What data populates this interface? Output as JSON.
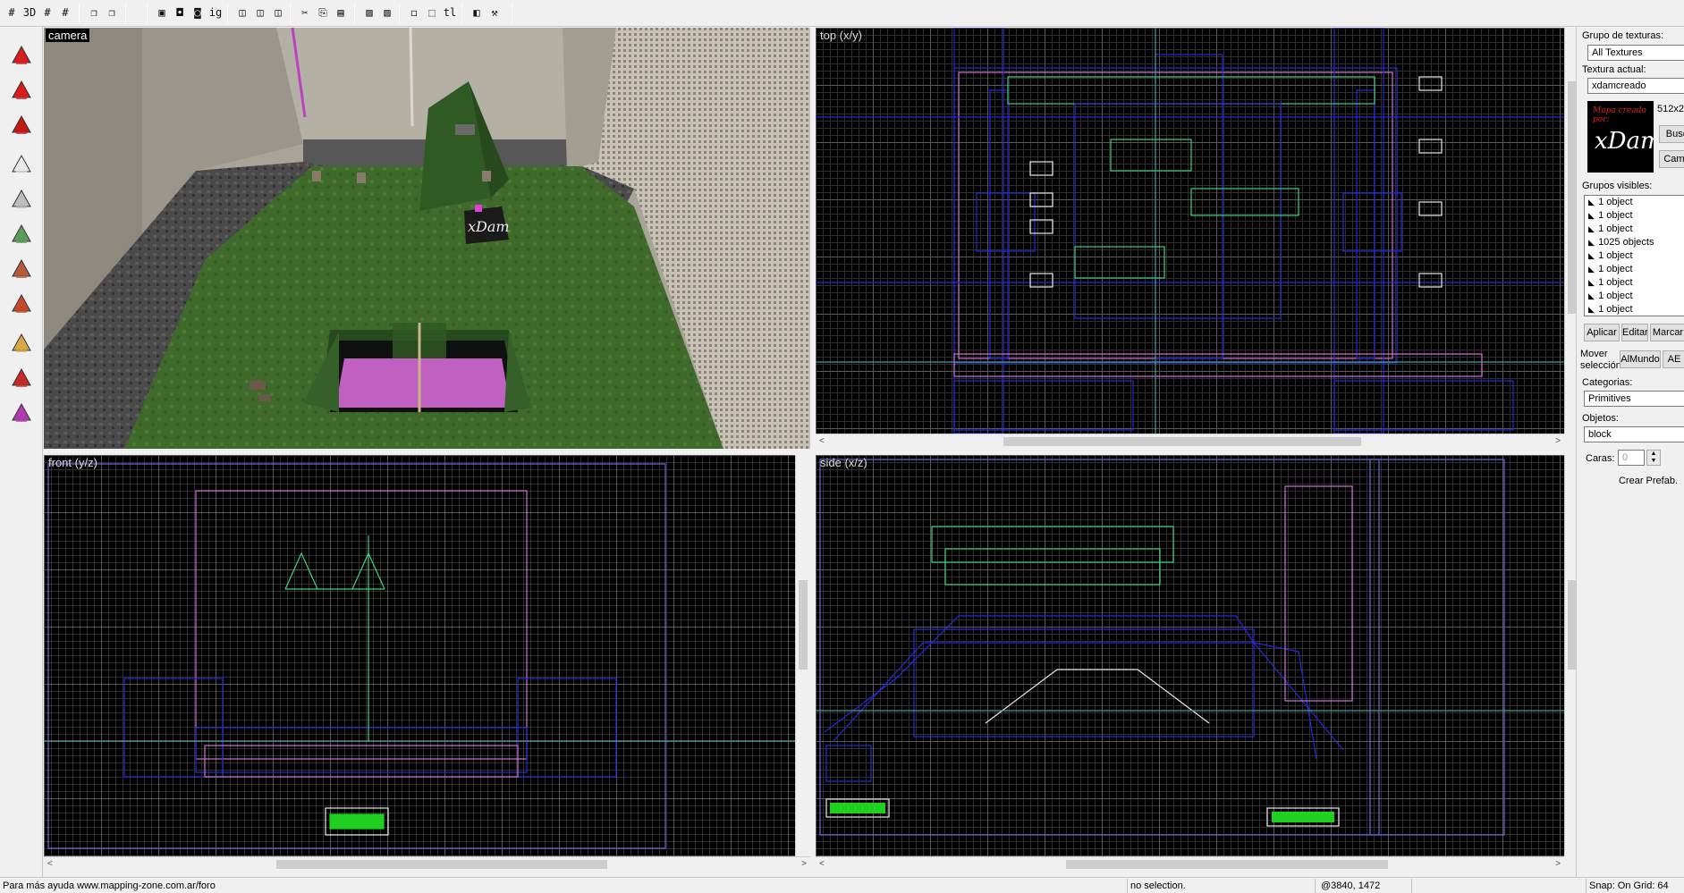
{
  "toolbar": {
    "buttons": [
      {
        "name": "grid-icon",
        "glyph": "#"
      },
      {
        "name": "grid-3d-icon",
        "glyph": "3D"
      },
      {
        "name": "grid-small-icon",
        "glyph": "#"
      },
      {
        "name": "grid-add-icon",
        "glyph": "#"
      },
      {
        "name": "layers-icon",
        "glyph": "❐"
      },
      {
        "name": "layers-alt-icon",
        "glyph": "❐"
      },
      {
        "name": "save-icon",
        "glyph": "▣"
      },
      {
        "name": "camera-icon",
        "glyph": "◘"
      },
      {
        "name": "map-icon",
        "glyph": "◙"
      },
      {
        "name": "ig-icon",
        "glyph": "ig"
      },
      {
        "name": "brush-red-icon",
        "glyph": "◫"
      },
      {
        "name": "brush-outline-icon",
        "glyph": "◫"
      },
      {
        "name": "brush-clone-icon",
        "glyph": "◫"
      },
      {
        "name": "cut-icon",
        "glyph": "✂"
      },
      {
        "name": "copy-icon",
        "glyph": "⎘"
      },
      {
        "name": "paste-icon",
        "glyph": "▤"
      },
      {
        "name": "hazard-icon",
        "glyph": "▨"
      },
      {
        "name": "hazard-x-icon",
        "glyph": "▨"
      },
      {
        "name": "select-box-icon",
        "glyph": "◻"
      },
      {
        "name": "select-cursor-icon",
        "glyph": "⬚"
      },
      {
        "name": "tl-icon",
        "glyph": "tl"
      },
      {
        "name": "flip-icon",
        "glyph": "◧"
      },
      {
        "name": "tools-icon",
        "glyph": "⚒"
      }
    ]
  },
  "palette": {
    "tools": [
      {
        "name": "pointer-tool-icon",
        "color": "#d91c1c"
      },
      {
        "name": "magnify-tool-icon",
        "color": "#d91c1c"
      },
      {
        "name": "cube-red-tool-icon",
        "color": "#c41a1a"
      },
      {
        "name": "light-tool-icon",
        "color": "#e8e8e8"
      },
      {
        "name": "block-tool-icon",
        "color": "#bdbdbd"
      },
      {
        "name": "texture-tool-icon",
        "color": "#5a9c5a"
      },
      {
        "name": "texture-brown-tool-icon",
        "color": "#b45a3c"
      },
      {
        "name": "clip-tool-icon",
        "color": "#c44a2a"
      },
      {
        "name": "decal-tool-icon",
        "color": "#d8a848"
      },
      {
        "name": "vertex-tool-icon",
        "color": "#c42a2a"
      },
      {
        "name": "path-tool-icon",
        "color": "#b03ab0"
      }
    ]
  },
  "viewports": {
    "camera": {
      "label": "camera"
    },
    "top": {
      "label": "top (x/y)"
    },
    "front": {
      "label": "front (y/z)"
    },
    "side": {
      "label": "side (x/z)"
    }
  },
  "camera_scene": {
    "sign_text": "xDam"
  },
  "right_panel": {
    "texture_group_label": "Grupo de texturas:",
    "texture_group_value": "All Textures",
    "current_texture_label": "Textura actual:",
    "current_texture_value": "xdamcreado",
    "texture_size": "512x2",
    "preview_line1": "Mapa creado por:",
    "preview_line2": "xDam'",
    "search_button": "Busc",
    "change_button": "Camb",
    "visible_groups_label": "Grupos visibles:",
    "groups": [
      "1 object",
      "1 object",
      "1 object",
      "1025 objects",
      "1 object",
      "1 object",
      "1 object",
      "1 object",
      "1 object"
    ],
    "apply_button": "Aplicar",
    "edit_button": "Editar",
    "mark_button": "Marcar",
    "move_selection_label_1": "Mover",
    "move_selection_label_2": "selección:",
    "world_button": "AlMundo",
    "ae_button": "AE",
    "categories_label": "Categorias:",
    "categories_value": "Primitives",
    "objects_label": "Objetos:",
    "objects_value": "block",
    "faces_label": "Caras:",
    "faces_value": "0",
    "create_prefab_button": "Crear Prefab."
  },
  "statusbar": {
    "help_text": "Para más ayuda www.mapping-zone.com.ar/foro",
    "selection_text": "no selection.",
    "coords_text": "@3840, 1472",
    "snap_text": "Snap: On Grid: 64"
  },
  "colors": {
    "grid_major": "#5a5a5a",
    "grid_minor": "#2e2e2e",
    "brush_blue": "#2a2ad8",
    "brush_pink": "#d070d0",
    "brush_green": "#40d080",
    "brush_white": "#e8e8e8"
  }
}
